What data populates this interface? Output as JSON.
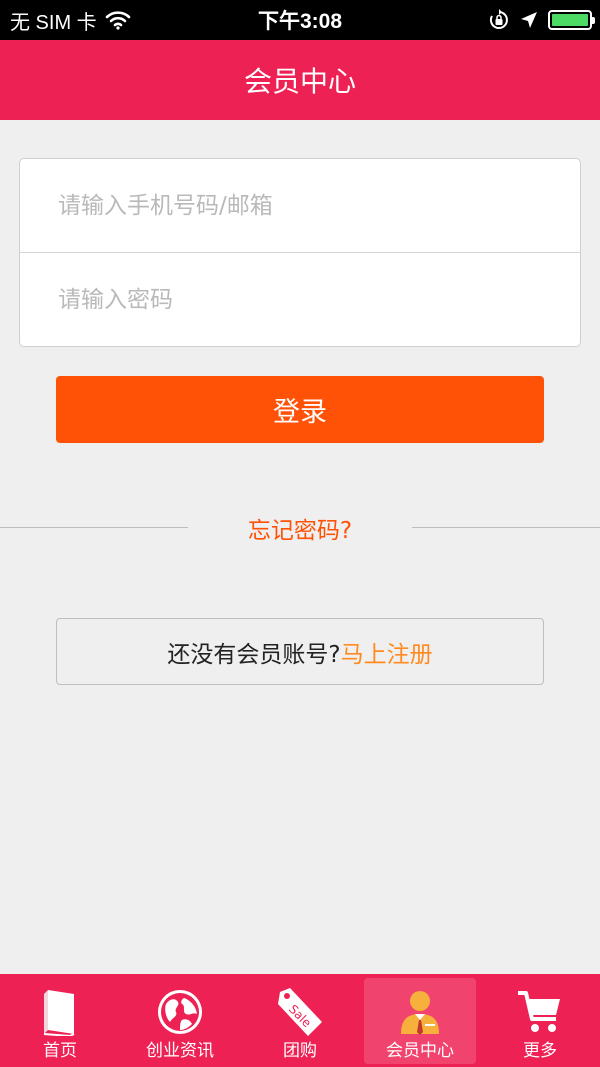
{
  "status_bar": {
    "carrier": "无 SIM 卡",
    "time": "下午3:08"
  },
  "nav": {
    "title": "会员中心"
  },
  "login": {
    "account_placeholder": "请输入手机号码/邮箱",
    "password_placeholder": "请输入密码",
    "submit_label": "登录"
  },
  "forgot": {
    "label": "忘记密码?"
  },
  "register": {
    "prompt": "还没有会员账号?",
    "link": "马上注册"
  },
  "tabs": [
    {
      "label": "首页",
      "icon": "book-icon"
    },
    {
      "label": "创业资讯",
      "icon": "globe-icon"
    },
    {
      "label": "团购",
      "icon": "sale-tag-icon"
    },
    {
      "label": "会员中心",
      "icon": "member-icon",
      "active": true
    },
    {
      "label": "更多",
      "icon": "cart-icon"
    }
  ],
  "colors": {
    "brand": "#ee2154",
    "accent": "#ff5206",
    "link": "#ff8a1f",
    "background": "#efefef"
  }
}
